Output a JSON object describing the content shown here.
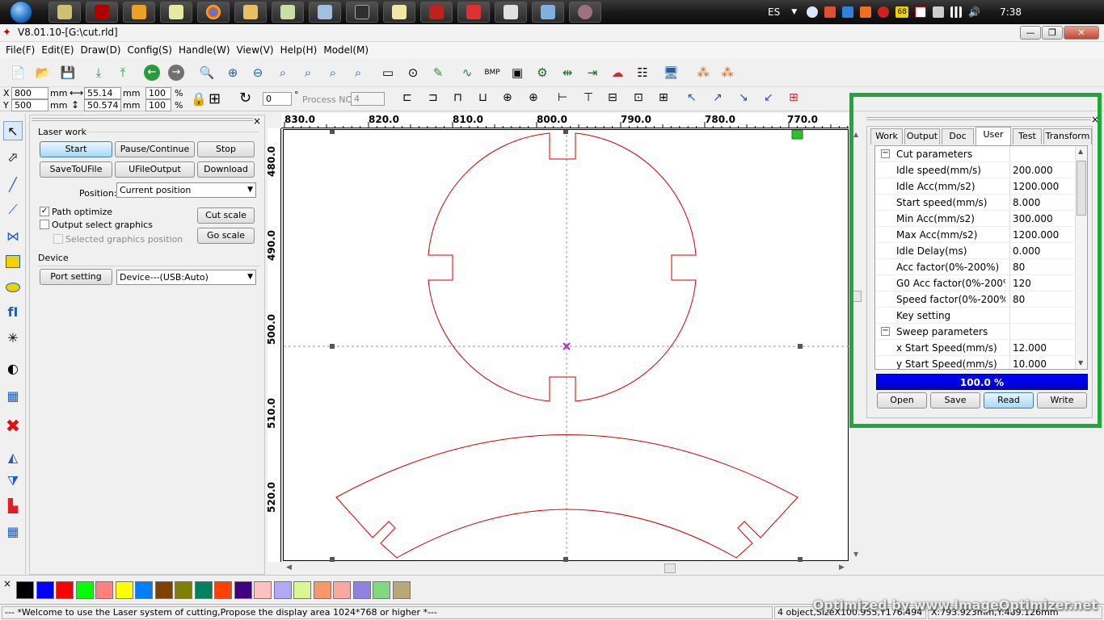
{
  "taskbar": {
    "language": "ES",
    "clock": "7:38",
    "badge_number": "68",
    "apps": [
      "settings-app-icon",
      "pcb-app-icon",
      "media-player-icon",
      "notepad-plus-icon",
      "chrome-icon",
      "explorer-icon",
      "files-icon",
      "document-icon",
      "inkscape-icon",
      "notes-icon",
      "autocad-icon",
      "laser-app-icon",
      "design-app-icon",
      "window-app-icon",
      "paint-app-icon"
    ]
  },
  "window": {
    "title": "V8.01.10-[G:\\cut.rld]",
    "minimize": "—",
    "maximize": "❐",
    "close": "✕"
  },
  "menu": [
    "File(F)",
    "Edit(E)",
    "Draw(D)",
    "Config(S)",
    "Handle(W)",
    "View(V)",
    "Help(H)",
    "Model(M)"
  ],
  "toolbar2": {
    "x_label": "X",
    "y_label": "Y",
    "x_value": "800",
    "y_value": "500",
    "unit": "mm",
    "width_value": "55.14",
    "height_value": "50.574",
    "scale_x": "100",
    "scale_y": "100",
    "percent": "%",
    "rotate_value": "0",
    "degree": "°",
    "process_label": "Process NO:",
    "process_value": "4"
  },
  "laser_work": {
    "title": "Laser work",
    "start": "Start",
    "pause": "Pause/Continue",
    "stop": "Stop",
    "save_to_ufile": "SaveToUFile",
    "ufile_output": "UFileOutput",
    "download": "Download",
    "position_label": "Position:",
    "position_value": "Current position",
    "path_optimize": "Path optimize",
    "path_optimize_checked": "✓",
    "output_select": "Output select graphics",
    "selected_position": "Selected graphics position",
    "cut_scale": "Cut scale",
    "go_scale": "Go scale",
    "device_title": "Device",
    "port_setting": "Port setting",
    "device_value": "Device---(USB:Auto)",
    "panel_close": "×"
  },
  "rulers": {
    "top": [
      "830.0",
      "820.0",
      "810.0",
      "800.0",
      "790.0",
      "780.0",
      "770.0"
    ],
    "left": [
      "480.0",
      "490.0",
      "500.0",
      "510.0",
      "520.0"
    ]
  },
  "user_panel": {
    "tabs": [
      "Work",
      "Output",
      "Doc",
      "User",
      "Test",
      "Transform"
    ],
    "selected_tab": "User",
    "rows": [
      {
        "key": "Cut parameters",
        "value": "",
        "category": true
      },
      {
        "key": "Idle speed(mm/s)",
        "value": "200.000"
      },
      {
        "key": "Idle Acc(mm/s2)",
        "value": "1200.000"
      },
      {
        "key": "Start speed(mm/s)",
        "value": "8.000"
      },
      {
        "key": "Min Acc(mm/s2)",
        "value": "300.000"
      },
      {
        "key": "Max Acc(mm/s2)",
        "value": "1200.000"
      },
      {
        "key": "Idle Delay(ms)",
        "value": "0.000"
      },
      {
        "key": "Acc factor(0%-200%)",
        "value": "80"
      },
      {
        "key": "G0 Acc factor(0%-200%",
        "value": "120"
      },
      {
        "key": "Speed factor(0%-200%",
        "value": "80"
      },
      {
        "key": "Key setting",
        "value": ""
      },
      {
        "key": "Sweep parameters",
        "value": "",
        "category": true
      },
      {
        "key": "x Start Speed(mm/s)",
        "value": "12.000"
      },
      {
        "key": "y Start Speed(mm/s)",
        "value": "10.000"
      }
    ],
    "collapse_symbol": "−",
    "progress_text": "100.0  %",
    "progress_fraction": 1.0,
    "open": "Open",
    "save": "Save",
    "read": "Read",
    "write": "Write",
    "panel_close": "×"
  },
  "palette": {
    "close": "×",
    "colors": [
      "#000000",
      "#0000ff",
      "#ff0000",
      "#00ff00",
      "#ff8080",
      "#ffff00",
      "#0080ff",
      "#804000",
      "#808000",
      "#008060",
      "#ff4000",
      "#400080",
      "#ffc0c0",
      "#b0a8f8",
      "#d8f890",
      "#f89868",
      "#f8a8a0",
      "#9080e0",
      "#80d880",
      "#b8a878"
    ]
  },
  "status": {
    "message": "--- *Welcome to use the Laser system of cutting,Propose the display area 1024*768 or higher *---",
    "objects": "4 object,SizeX100.955,Y176.494",
    "coords": "X:793.923mm,Y:489.126mm"
  },
  "watermark": "Optimized by www.ImageOptimizer.net",
  "colors": {
    "highlight": "#1fa83a",
    "drawing": "#d00000",
    "progress": "#0000ff"
  }
}
